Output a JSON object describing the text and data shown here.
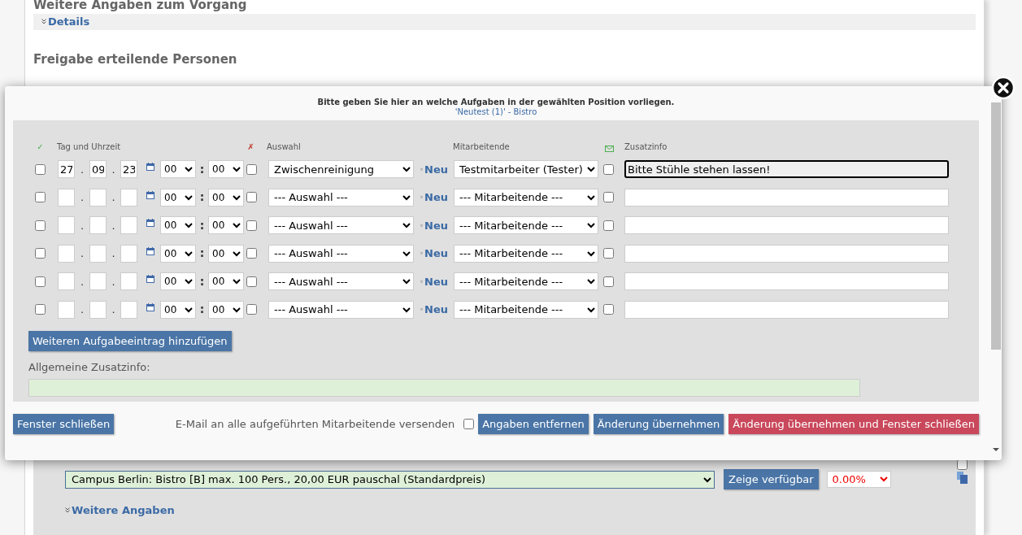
{
  "page": {
    "section_title": "Weitere Angaben zum Vorgang",
    "details_link": "Details",
    "persons_title": "Freigabe erteilende Personen",
    "location_select": "Campus Berlin: Bistro [B] max. 100 Pers., 20,00 EUR pauschal (Standardpreis)",
    "show_button": "Zeige verfügbar",
    "discount_select": "0.00%",
    "row_checked": false,
    "more_link": "Weitere Angaben"
  },
  "dialog": {
    "instruction": "Bitte geben Sie hier an welche Aufgaben in der gewählten Position vorliegen.",
    "position_link": "'Neutest (1)'",
    "position_suffix": "- Bistro",
    "columns": {
      "done": "✓",
      "date_time": "Tag und Uhrzeit",
      "cancel": "✗",
      "selection": "Auswahl",
      "staff": "Mitarbeitende",
      "info": "Zusatzinfo"
    },
    "rows": [
      {
        "checked": false,
        "day": "27",
        "sep1": ".",
        "month": "09",
        "sep2": ".",
        "year": "23",
        "hour": "00",
        "time_sep": ":",
        "minute": "00",
        "cancelled": false,
        "task": "Zwischenreinigung",
        "new_link": "Neu",
        "staff": "Testmitarbeiter (Tester)",
        "notify": false,
        "info": "Bitte Stühle stehen lassen!",
        "focused": true
      },
      {
        "checked": false,
        "sep1": ".",
        "sep2": ".",
        "hour": "00",
        "time_sep": ":",
        "minute": "00",
        "cancelled": false,
        "task": "--- Auswahl ---",
        "new_link": "Neu",
        "staff": "--- Mitarbeitende ---",
        "notify": false,
        "focused": false
      },
      {
        "checked": false,
        "sep1": ".",
        "sep2": ".",
        "hour": "00",
        "time_sep": ":",
        "minute": "00",
        "cancelled": false,
        "task": "--- Auswahl ---",
        "new_link": "Neu",
        "staff": "--- Mitarbeitende ---",
        "notify": false,
        "focused": false
      },
      {
        "checked": false,
        "sep1": ".",
        "sep2": ".",
        "hour": "00",
        "time_sep": ":",
        "minute": "00",
        "cancelled": false,
        "task": "--- Auswahl ---",
        "new_link": "Neu",
        "staff": "--- Mitarbeitende ---",
        "notify": false,
        "focused": false
      },
      {
        "checked": false,
        "sep1": ".",
        "sep2": ".",
        "hour": "00",
        "time_sep": ":",
        "minute": "00",
        "cancelled": false,
        "task": "--- Auswahl ---",
        "new_link": "Neu",
        "staff": "--- Mitarbeitende ---",
        "notify": false,
        "focused": false
      },
      {
        "checked": false,
        "sep1": ".",
        "sep2": ".",
        "hour": "00",
        "time_sep": ":",
        "minute": "00",
        "cancelled": false,
        "task": "--- Auswahl ---",
        "new_link": "Neu",
        "staff": "--- Mitarbeitende ---",
        "notify": false,
        "focused": false
      }
    ],
    "add_button": "Weiteren Aufgabeeintrag hinzufügen",
    "general_info_label": "Allgemeine Zusatzinfo:",
    "close_button": "Fenster schließen",
    "email_label": "E-Mail an alle aufgeführten Mitarbeitende versenden",
    "email_checked": false,
    "buttons": [
      {
        "label": "Angaben entfernen",
        "kind": "primary"
      },
      {
        "label": "Änderung übernehmen",
        "kind": "primary"
      },
      {
        "label": "Änderung übernehmen und Fenster schließen",
        "kind": "danger"
      }
    ]
  }
}
